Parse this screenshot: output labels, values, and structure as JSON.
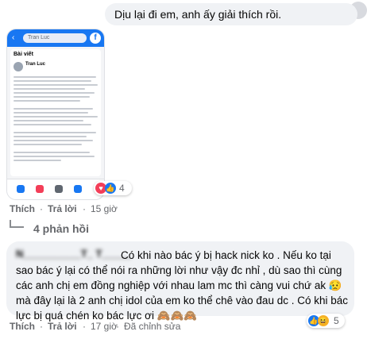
{
  "first_comment": {
    "text": "Dịu lại đi em, anh ấy giải thích rồi."
  },
  "screenshot": {
    "search_text": "Tran Luc",
    "section_title": "Bài viết",
    "author_name": "Tran Luc",
    "fb_glyph": "f",
    "back_glyph": "‹"
  },
  "image_comment": {
    "reaction_icons": [
      "heart",
      "like"
    ],
    "reaction_count": "4",
    "actions": {
      "like": "Thích",
      "separator": "·",
      "reply": "Trả lời",
      "time": "15 giờ"
    }
  },
  "replies": {
    "label": "4 phản hồi"
  },
  "second_comment": {
    "author": "N__________T_ T_____",
    "text": "Có khi nào bác ý bị hack nick ko . Nếu ko tại sao bác ý lại có thể nói ra những lời như vậy đc nhỉ , dù sao thì cùng các anh chị em đồng nghiệp với nhau lam mc thì càng vui chứ ak 😥mà đây lại là 2 anh chị idol của em ko thể chê vào đau dc . Có khi bác lực bị quá chén ko bác lực ơi 🙈🙈🙈",
    "reaction_icons": [
      "like",
      "haha"
    ],
    "reaction_count": "5",
    "actions": {
      "like": "Thích",
      "separator": "·",
      "reply": "Trả lời",
      "time": "17 giờ",
      "edited": "Đã chỉnh sửa"
    }
  },
  "colors": {
    "bubble": "#f0f2f5",
    "meta_text": "#65676b",
    "facebook_blue": "#1877f2",
    "love_red": "#f33e58",
    "haha_yellow": "#f7b125"
  }
}
